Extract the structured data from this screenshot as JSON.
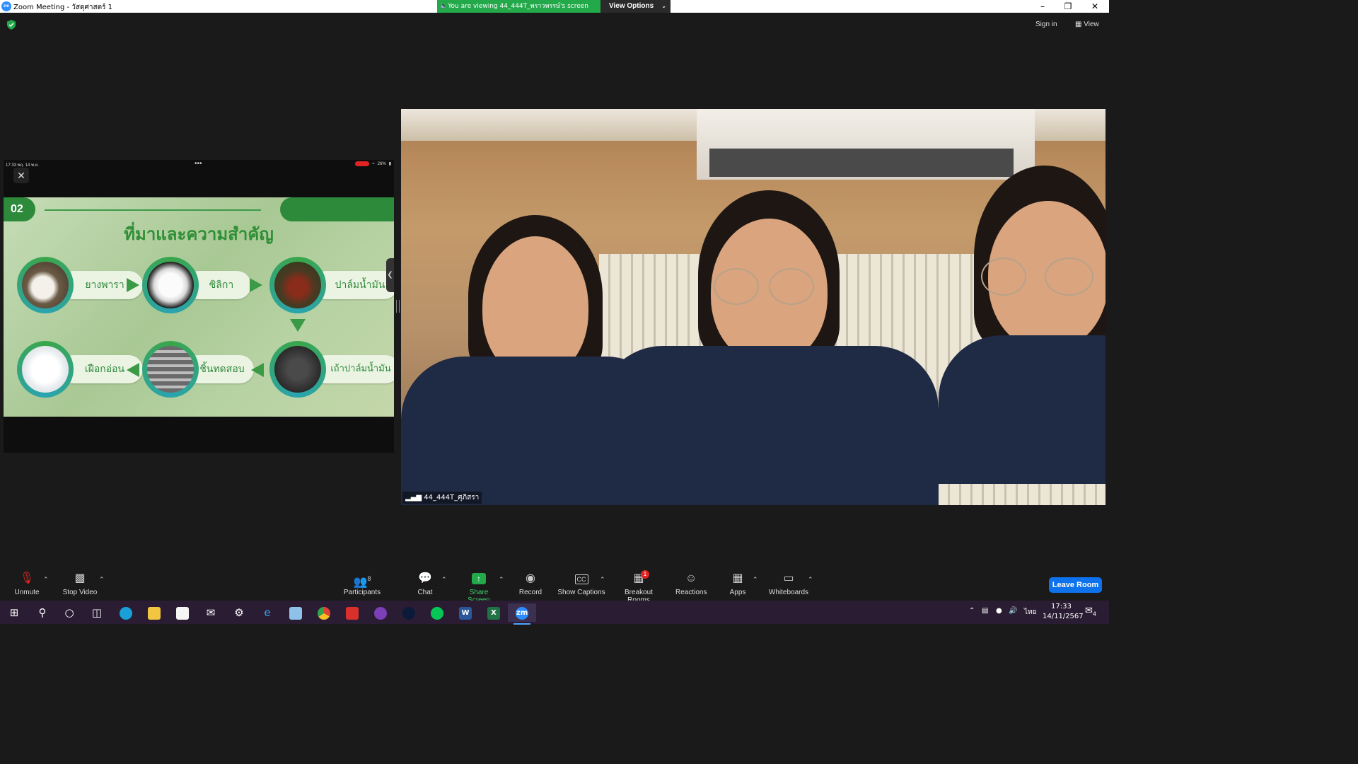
{
  "window": {
    "title": "Zoom Meeting - วัสดุศาสตร์ 1",
    "app_icon": "zm"
  },
  "banner": {
    "viewing_text": "You are viewing 44_444T_พราวพรรษ์'s screen",
    "view_options_label": "View Options"
  },
  "top_right": {
    "sign_in": "Sign in",
    "view": "View"
  },
  "shared_screen": {
    "status_time": "17:33  พฤ. 14 พ.ย.",
    "battery": "26%",
    "slide": {
      "number": "02",
      "title": "ที่มาและความสำคัญ",
      "nodes": [
        {
          "label": "ยางพารา"
        },
        {
          "label": "ซิลิกา"
        },
        {
          "label": "ปาล์มน้ำมัน"
        },
        {
          "label": "เถ้าปาล์มน้ำมัน"
        },
        {
          "label": "ชิ้นทดสอบ"
        },
        {
          "label": "เฝือกอ่อน"
        }
      ]
    }
  },
  "video": {
    "participant_name": "44_444T_ศุภิสรา"
  },
  "toolbar": {
    "unmute": "Unmute",
    "stop_video": "Stop Video",
    "participants": "Participants",
    "participants_count": "8",
    "chat": "Chat",
    "share_screen": "Share Screen",
    "record": "Record",
    "show_captions": "Show Captions",
    "breakout_rooms": "Breakout Rooms",
    "breakout_badge": "1",
    "reactions": "Reactions",
    "apps": "Apps",
    "whiteboards": "Whiteboards",
    "leave_room": "Leave Room"
  },
  "taskbar": {
    "time": "17:33",
    "date": "14/11/2567",
    "language": "ไทย",
    "notification_count": "4",
    "zoom_label": "zm"
  },
  "colors": {
    "zoom_blue": "#0e72ed",
    "share_green": "#23a84a",
    "slide_green": "#2c8a3a"
  }
}
